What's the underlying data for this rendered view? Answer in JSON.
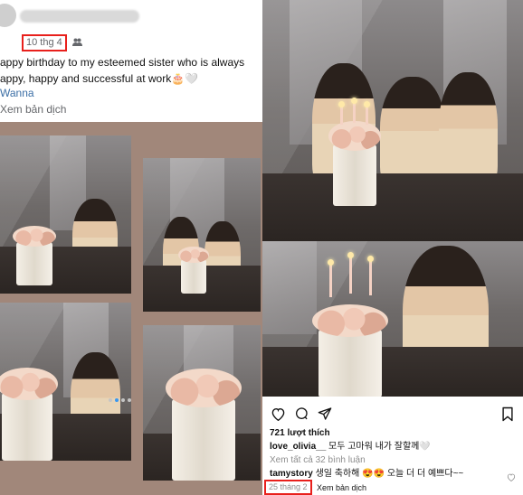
{
  "facebook_post": {
    "date": "10 thg 4",
    "caption_line1": "appy birthday to my esteemed sister who is always",
    "caption_line2": "appy, happy and successful at work",
    "caption_emoji": "🎂🤍",
    "tag": "Wanna",
    "translate_label": "Xem bản dịch"
  },
  "instagram_post": {
    "likes": "721 lượt thích",
    "comment1": {
      "user": "love_olivia__",
      "text": "모두 고마워 내가 잘할께🤍"
    },
    "view_comments": "Xem tất cả 32 bình luận",
    "comment2": {
      "user": "tamystory",
      "text": "생일 축하해 😍😍 오늘 더 더 예쁘다~~"
    },
    "date": "25 tháng 2",
    "translate_label": "Xem bản dịch"
  },
  "colors": {
    "highlight_box": "#e8201c",
    "collage_bg": "#a1877a",
    "ig_dot_active": "#3897f0",
    "link_blue": "#3b6ea5"
  },
  "icons": [
    "people-icon",
    "heart-icon",
    "comment-icon",
    "share-icon",
    "bookmark-icon",
    "small-heart-icon"
  ]
}
